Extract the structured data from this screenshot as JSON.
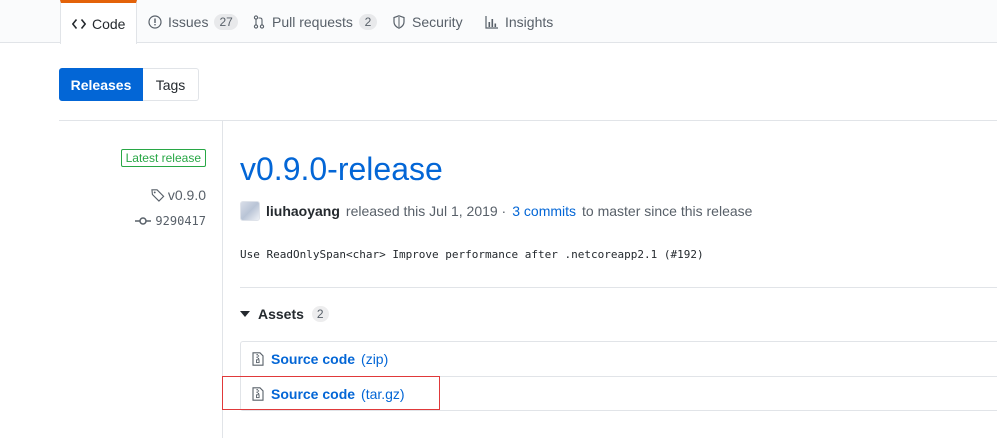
{
  "nav": {
    "tabs": [
      {
        "label": "Code",
        "icon": "code-icon",
        "selected": true
      },
      {
        "label": "Issues",
        "icon": "issue-icon",
        "count": "27"
      },
      {
        "label": "Pull requests",
        "icon": "pull-request-icon",
        "count": "2"
      },
      {
        "label": "Security",
        "icon": "shield-icon"
      },
      {
        "label": "Insights",
        "icon": "graph-icon"
      }
    ]
  },
  "subnav": {
    "releases_label": "Releases",
    "tags_label": "Tags"
  },
  "release": {
    "latest_badge": "Latest release",
    "tag": "v0.9.0",
    "commit": "9290417",
    "title": "v0.9.0-release",
    "author": "liuhaoyang",
    "released_text": "released this Jul 1, 2019 ·",
    "commits_link": "3 commits",
    "commits_suffix": "to master since this release",
    "body": "Use ReadOnlySpan<char> Improve performance after .netcoreapp2.1 (#192)"
  },
  "assets": {
    "label": "Assets",
    "count": "2",
    "items": [
      {
        "name": "Source code",
        "kind": "(zip)"
      },
      {
        "name": "Source code",
        "kind": "(tar.gz)"
      }
    ]
  },
  "colors": {
    "accent": "#0366d6",
    "tab_underline": "#e36209",
    "latest_green": "#28a745",
    "annotation_red": "#e0393a"
  }
}
